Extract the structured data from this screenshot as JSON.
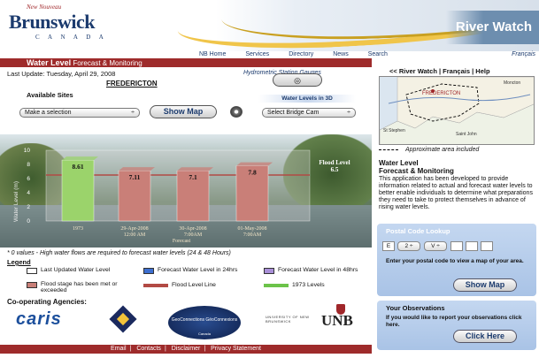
{
  "header": {
    "logo_top": "New Nouveau",
    "logo_main": "Brunswick",
    "logo_sub": "C A N A D A",
    "site_title": "River Watch"
  },
  "nav": [
    "NB Home",
    "Services",
    "Directory",
    "News",
    "Search"
  ],
  "nav_french": "Français",
  "page": {
    "title": "Water Level",
    "subtitle": "Forecast & Monitoring",
    "last_update": "Last Update: Tuesday, April 29, 2008",
    "city": "FREDERICTON",
    "hydrometric_link": "Hydrometric Station Gauges",
    "available_sites": "Available Sites",
    "site_select": "Make a selection",
    "show_map": "Show Map",
    "water_levels_3d": "Water Levels in 3D",
    "cam_select": "Select Bridge Cam"
  },
  "chart_data": {
    "type": "bar",
    "categories": [
      "1973",
      "29-Apr-2008 12:00 AM",
      "30-Apr-2008 7:00AM",
      "01-May-2008 7:00AM"
    ],
    "values": [
      8.61,
      7.11,
      7.1,
      7.8
    ],
    "value_labels": [
      "8.61",
      "7.11",
      "7.1",
      "7.8"
    ],
    "category_labels": [
      [
        "1973"
      ],
      [
        "29-Apr-2008",
        "12:00 AM"
      ],
      [
        "30-Apr-2008",
        "7:00AM"
      ],
      [
        "01-May-2008",
        "7:00AM"
      ]
    ],
    "ylabel": "Water Level (m)",
    "forecast_label": "Forecast",
    "yticks": [
      0,
      2,
      4,
      6,
      8,
      10
    ],
    "ylim": [
      0,
      10
    ],
    "flood_level": 6.5,
    "flood_label": "Flood Level",
    "flood_value_label": "6.5",
    "colors": {
      "1973": "#9bd36b",
      "forecast": "#c97f78",
      "flood_line": "#b24a44"
    }
  },
  "note": "* 0 values - High water flows are required to forecast water levels (24 & 48 Hours)",
  "legend": {
    "title": "Legend",
    "items": [
      {
        "label": "Last Updated Water Level",
        "color": "#ffffff"
      },
      {
        "label": "Forecast Water Level in 24hrs",
        "color": "#3d6fd0"
      },
      {
        "label": "Forecast Water Level in 48hrs",
        "color": "#a98fd8"
      },
      {
        "label": "Flood stage has been met or exceeded",
        "color": "#c97f78"
      },
      {
        "label": "Flood Level Line",
        "color": "#b24a44"
      },
      {
        "label": "1973 Levels",
        "color": "#6cc34a"
      }
    ]
  },
  "coop": {
    "title": "Co-operating Agencies:",
    "caris": "caris",
    "geo": "GeoConnections GéoConnexions",
    "geo_sub": "Canada",
    "unb_small": "UNIVERSITY OF NEW BRUNSWICK",
    "unb": "UNB"
  },
  "footer": [
    "Email",
    "Contacts",
    "Disclaimer",
    "Privacy Statement"
  ],
  "right": {
    "links": "<< River Watch  |  Français  |  Help",
    "map_labels": [
      "FREDERICTON",
      "Moncton",
      "St Stephen",
      "Saint John"
    ],
    "approx": "Approximate area included",
    "title1": "Water Level",
    "title2": "Forecast & Monitoring",
    "desc": "This application has been developed to provide information related to actual and forecast water levels to better enable individuals to determine what preparations they need to take to protect themselves in advance of rising water levels."
  },
  "postal": {
    "title": "Postal Code Lookup",
    "boxes": [
      "E",
      "2",
      "V"
    ],
    "text": "Enter your postal code to view a map of your area.",
    "button": "Show Map"
  },
  "observations": {
    "title": "Your Observations",
    "text": "If you would like to report your observations click here.",
    "button": "Click Here"
  }
}
